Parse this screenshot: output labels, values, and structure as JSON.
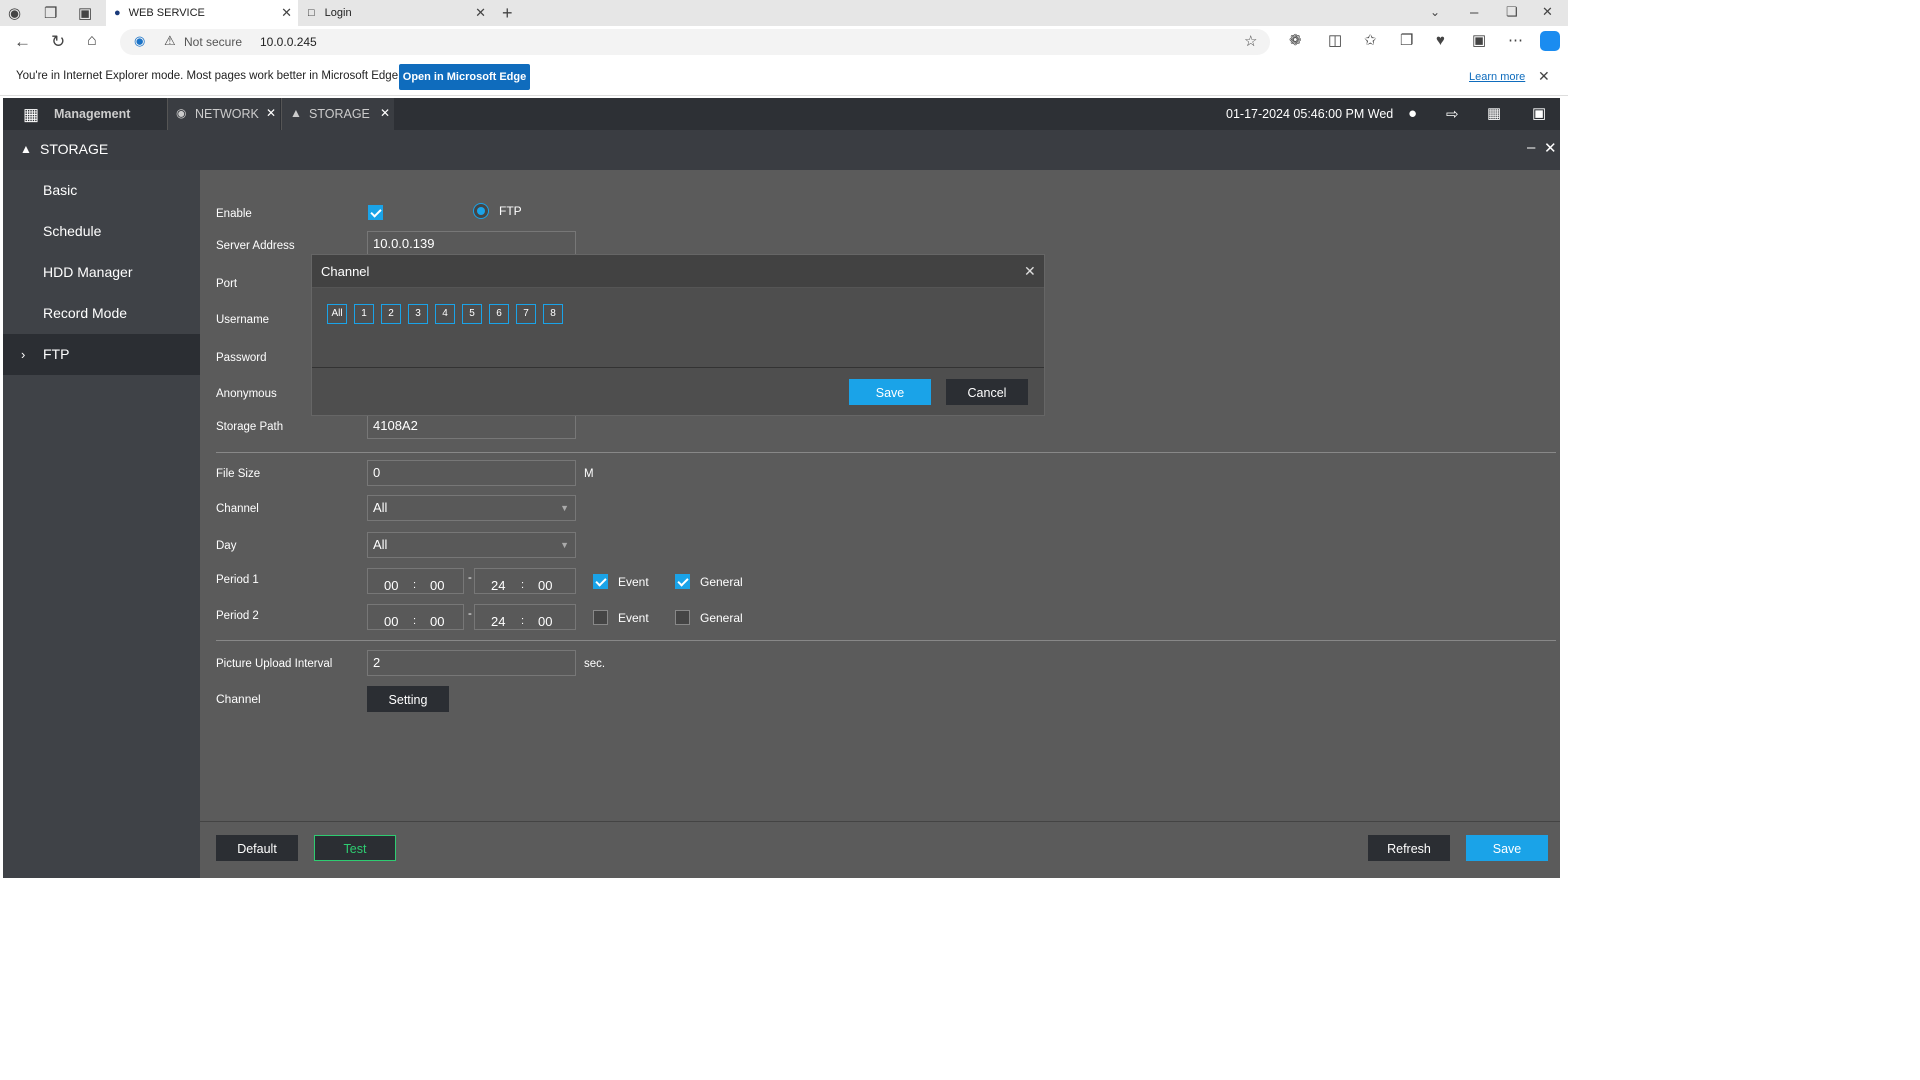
{
  "browser": {
    "tabs": [
      {
        "title": "WEB SERVICE"
      },
      {
        "title": "Login"
      }
    ],
    "security": "Not secure",
    "url": "10.0.0.245",
    "ie_mode_text": "You're in Internet Explorer mode. Most pages work better in Microsoft Edge.",
    "open_edge_label": "Open in Microsoft Edge",
    "learn_more": "Learn more"
  },
  "topnav": {
    "management": "Management",
    "tabs": [
      {
        "label": "NETWORK"
      },
      {
        "label": "STORAGE"
      }
    ],
    "datetime": "01-17-2024 05:46:00 PM Wed"
  },
  "page_title": "STORAGE",
  "sidebar": {
    "items": [
      {
        "label": "Basic"
      },
      {
        "label": "Schedule"
      },
      {
        "label": "HDD Manager"
      },
      {
        "label": "Record Mode"
      },
      {
        "label": "FTP",
        "selected": true
      }
    ]
  },
  "form": {
    "enable_label": "Enable",
    "enable_checked": true,
    "ftp_label": "FTP",
    "server_label": "Server Address",
    "server_value": "10.0.0.139",
    "port_label": "Port",
    "username_label": "Username",
    "password_label": "Password",
    "anonymous_label": "Anonymous",
    "storage_path_label": "Storage Path",
    "storage_path_value": "4108A2",
    "file_size_label": "File Size",
    "file_size_value": "0",
    "file_size_unit": "M",
    "channel_label": "Channel",
    "channel_value": "All",
    "day_label": "Day",
    "day_value": "All",
    "period1_label": "Period 1",
    "period2_label": "Period 2",
    "time_sep": ":",
    "range_sep": "-",
    "period1": {
      "start_h": "00",
      "start_m": "00",
      "end_h": "24",
      "end_m": "00",
      "event": true,
      "general": true
    },
    "period2": {
      "start_h": "00",
      "start_m": "00",
      "end_h": "24",
      "end_m": "00",
      "event": false,
      "general": false
    },
    "event_label": "Event",
    "general_label": "General",
    "pic_interval_label": "Picture Upload Interval",
    "pic_interval_value": "2",
    "pic_interval_unit": "sec.",
    "channel2_label": "Channel",
    "setting_label": "Setting"
  },
  "footer": {
    "default": "Default",
    "test": "Test",
    "refresh": "Refresh",
    "save": "Save"
  },
  "modal": {
    "title": "Channel",
    "channels": [
      "All",
      "1",
      "2",
      "3",
      "4",
      "5",
      "6",
      "7",
      "8"
    ],
    "save": "Save",
    "cancel": "Cancel"
  },
  "colors": {
    "accent": "#1aa3e8",
    "test_green": "#2ecc71"
  }
}
